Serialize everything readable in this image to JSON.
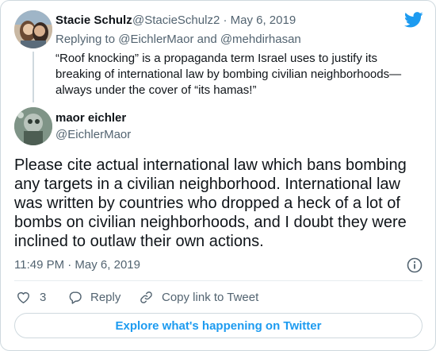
{
  "brand": {
    "accent": "#1d9bf0",
    "muted": "#536471",
    "text": "#0f1419"
  },
  "parent_tweet": {
    "name": "Stacie Schulz",
    "handle_date": "@StacieSchulz2 · May 6, 2019",
    "replying_to": "Replying to @EichlerMaor and @mehdirhasan",
    "text": "“Roof knocking” is a propaganda term Israel uses to justify its breaking of international law by bombing civilian neighborhoods—always under the cover of “its hamas!”"
  },
  "main_tweet": {
    "name": "maor eichler",
    "handle": "@EichlerMaor",
    "text": "Please cite actual international law which bans bombing any targets in a civilian neighborhood. International law was written by countries who dropped a heck of a lot of bombs on civilian neighborhoods, and I doubt they were inclined to outlaw their own actions.",
    "timestamp": "11:49 PM · May 6, 2019"
  },
  "actions": {
    "like_count": "3",
    "reply_label": "Reply",
    "copy_label": "Copy link to Tweet"
  },
  "footer": {
    "explore_label": "Explore what's happening on Twitter"
  },
  "icons": [
    "twitter-logo-icon",
    "info-icon",
    "heart-icon",
    "reply-icon",
    "link-icon"
  ]
}
